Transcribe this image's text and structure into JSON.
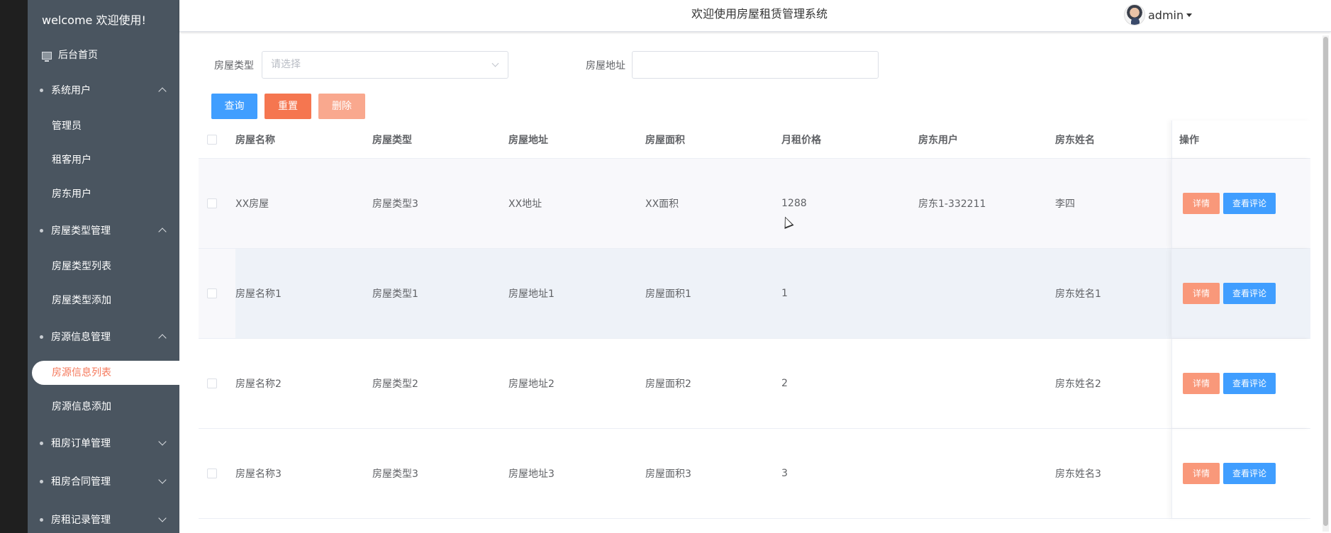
{
  "sidebar": {
    "welcome": "welcome 欢迎使用!",
    "home": "后台首页",
    "groups": [
      {
        "label": "系统用户",
        "expanded": true,
        "items": [
          "管理员",
          "租客用户",
          "房东用户"
        ]
      },
      {
        "label": "房屋类型管理",
        "expanded": true,
        "items": [
          "房屋类型列表",
          "房屋类型添加"
        ]
      },
      {
        "label": "房源信息管理",
        "expanded": true,
        "items": [
          "房源信息列表",
          "房源信息添加"
        ],
        "active": "房源信息列表"
      },
      {
        "label": "租房订单管理",
        "expanded": false,
        "items": []
      },
      {
        "label": "租房合同管理",
        "expanded": false,
        "items": []
      },
      {
        "label": "房租记录管理",
        "expanded": false,
        "items": []
      }
    ]
  },
  "header": {
    "title": "欢迎使用房屋租赁管理系统",
    "user": "admin"
  },
  "filters": {
    "type_label": "房屋类型",
    "type_placeholder": "请选择",
    "address_label": "房屋地址",
    "address_value": ""
  },
  "buttons": {
    "query": "查询",
    "reset": "重置",
    "delete": "删除"
  },
  "table": {
    "columns": [
      "房屋名称",
      "房屋类型",
      "房屋地址",
      "房屋面积",
      "月租价格",
      "房东用户",
      "房东姓名",
      "操作"
    ],
    "rows": [
      [
        "XX房屋",
        "房屋类型3",
        "XX地址",
        "XX面积",
        "1288",
        "房东1-332211",
        "李四"
      ],
      [
        "房屋名称1",
        "房屋类型1",
        "房屋地址1",
        "房屋面积1",
        "1",
        "",
        "房东姓名1"
      ],
      [
        "房屋名称2",
        "房屋类型2",
        "房屋地址2",
        "房屋面积2",
        "2",
        "",
        "房东姓名2"
      ],
      [
        "房屋名称3",
        "房屋类型3",
        "房屋地址3",
        "房屋面积3",
        "3",
        "",
        "房东姓名3"
      ]
    ],
    "actions": {
      "detail": "详情",
      "reviews": "查看评论"
    }
  },
  "colors": {
    "sidebar_bg": "#4a5560",
    "primary": "#409eff",
    "accent": "#f57650",
    "active_text": "#f5795c"
  }
}
